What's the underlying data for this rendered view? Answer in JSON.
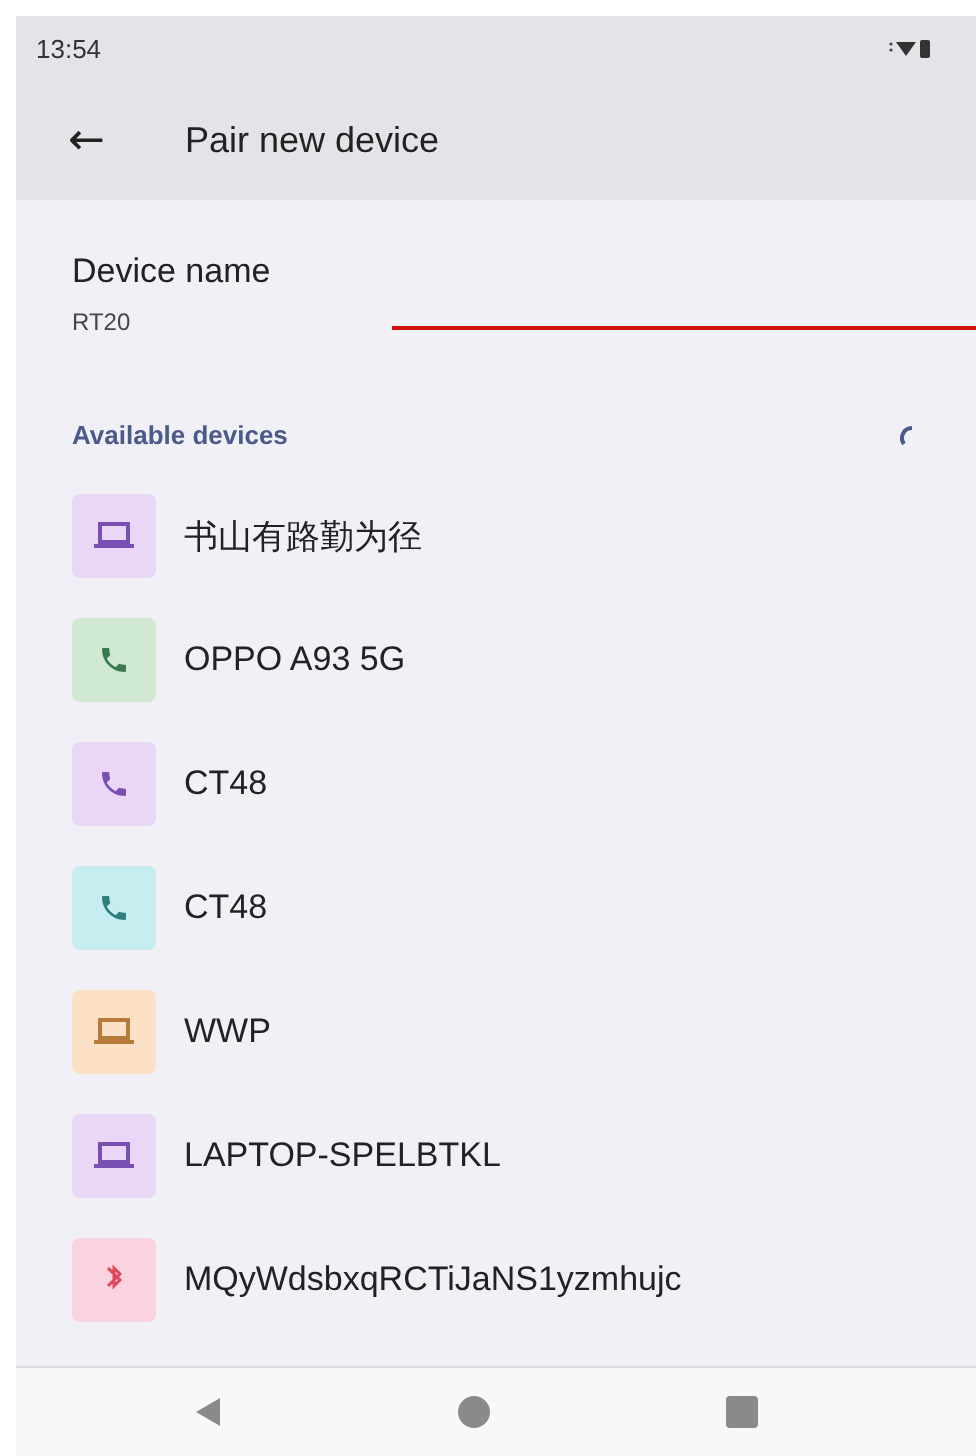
{
  "status_bar": {
    "time": "13:54"
  },
  "toolbar": {
    "back": "←",
    "title": "Pair new device"
  },
  "device_name": {
    "label": "Device name",
    "value": "RT20"
  },
  "section": {
    "title": "Available devices",
    "searching": true
  },
  "devices": [
    {
      "name": "书山有路勤为径",
      "kind": "laptop",
      "color": "#ead7f8"
    },
    {
      "name": "OPPO A93 5G",
      "kind": "phone",
      "color": "#cfe9d3"
    },
    {
      "name": "CT48",
      "kind": "phone",
      "color": "#ead7f8"
    },
    {
      "name": "CT48",
      "kind": "phone",
      "color": "#c6eef0"
    },
    {
      "name": "WWP",
      "kind": "laptop",
      "color": "#fde1c6"
    },
    {
      "name": "LAPTOP-SPELBTKL",
      "kind": "laptop",
      "color": "#ead7f8"
    },
    {
      "name": "MQyWdsbxqRCTiJaNS1yzmhujc",
      "kind": "other",
      "color": "#fbd3e0"
    }
  ]
}
